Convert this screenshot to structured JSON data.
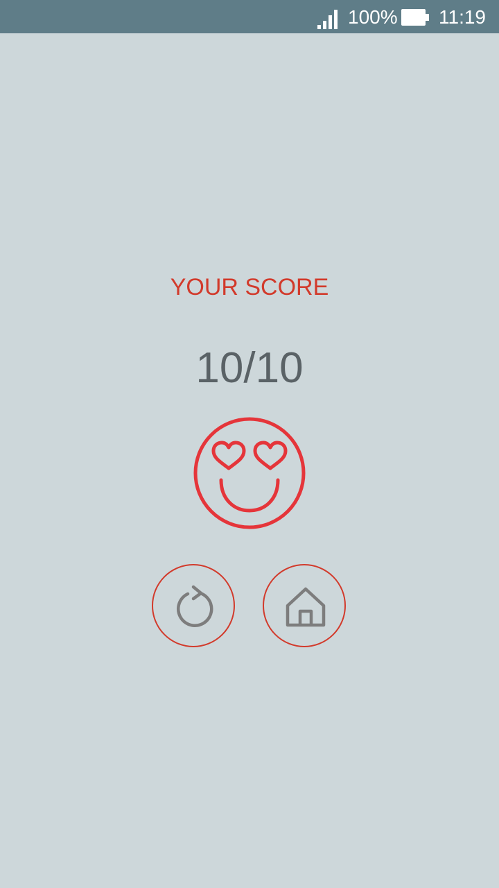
{
  "status_bar": {
    "battery_percent": "100%",
    "time": "11:19",
    "signal_icon": "signal-bars-icon",
    "battery_icon": "battery-full-icon"
  },
  "result": {
    "label": "YOUR SCORE",
    "score": "10/10",
    "emoji_icon": "heart-eyes-smiley-icon"
  },
  "actions": {
    "replay_icon": "replay-icon",
    "home_icon": "home-icon"
  },
  "colors": {
    "accent_red": "#d23a2b",
    "icon_gray": "#7d7d7d",
    "background": "#cdd7da",
    "status_bar": "#5f7d88"
  }
}
